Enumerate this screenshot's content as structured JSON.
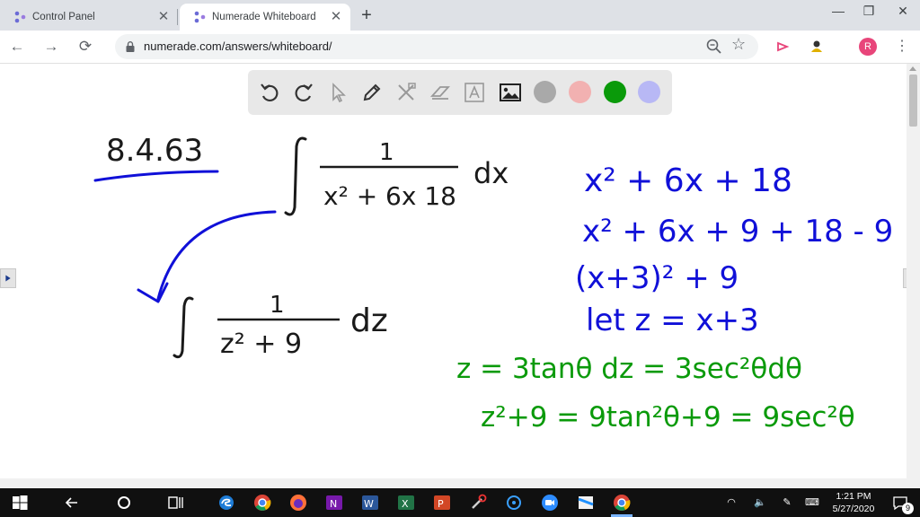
{
  "browser": {
    "tabs": [
      {
        "title": "Control Panel",
        "active": false
      },
      {
        "title": "Numerade Whiteboard",
        "active": true
      }
    ],
    "url": "numerade.com/answers/whiteboard/",
    "profile_initial": "R"
  },
  "toolbar": {
    "tools": [
      "undo-icon",
      "redo-icon",
      "pointer-icon",
      "pen-icon",
      "tools-icon",
      "eraser-icon",
      "text-icon",
      "image-icon"
    ],
    "colors": [
      "#a9a9a9",
      "#f2b1b1",
      "#0a9a0a",
      "#b8b8f5"
    ],
    "selected_color": "#0a9a0a"
  },
  "whiteboard": {
    "colors": {
      "black": "#1a1a1a",
      "blue": "#1010d8",
      "green": "#0a9a0a"
    },
    "problem_number": "8.4.63",
    "integral_numerator": "1",
    "integral_denominator": "x² + 6x 18",
    "integral_dx": "dx",
    "sub_numerator": "1",
    "sub_denominator": "z² + 9",
    "sub_dz": "dz",
    "steps_blue": [
      "x² + 6x + 18",
      "x² + 6x + 9 + 18 - 9",
      "(x+3)² + 9",
      "let z = x+3"
    ],
    "steps_green": [
      "z = 3tanθ   dz = 3sec²θdθ",
      "z²+9 = 9tan²θ+9 = 9sec²θ"
    ]
  },
  "taskbar": {
    "time": "1:21 PM",
    "date": "5/27/2020",
    "notification_count": "9"
  }
}
